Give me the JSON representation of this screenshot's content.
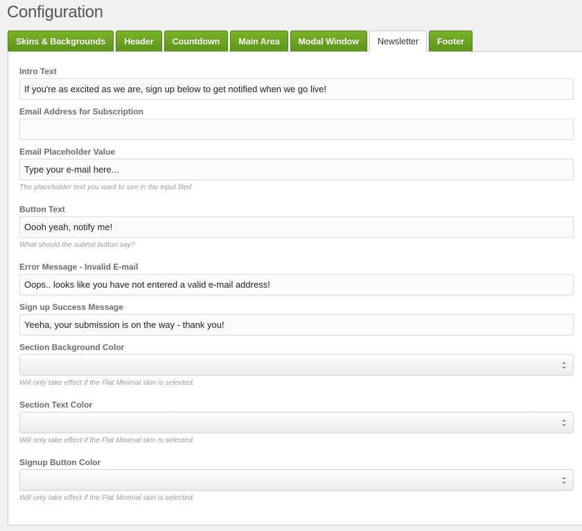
{
  "page": {
    "title": "Configuration"
  },
  "tabs": [
    {
      "label": "Skins & Backgrounds"
    },
    {
      "label": "Header"
    },
    {
      "label": "Countdown"
    },
    {
      "label": "Main Area"
    },
    {
      "label": "Modal Window"
    },
    {
      "label": "Newsletter"
    },
    {
      "label": "Footer"
    }
  ],
  "active_tab": "Newsletter",
  "fields": {
    "intro_text": {
      "label": "Intro Text",
      "value": "If you're as excited as we are, sign up below to get notified when we go live!"
    },
    "email_address": {
      "label": "Email Address for Subscription",
      "value": ""
    },
    "email_placeholder": {
      "label": "Email Placeholder Value",
      "value": "Type your e-mail here...",
      "help": "The placeholder text you want to see in the input filed"
    },
    "button_text": {
      "label": "Button Text",
      "value": "Oooh yeah, notify me!",
      "help": "What should the submit button say?"
    },
    "error_message": {
      "label": "Error Message - Invalid E-mail",
      "value": "Oops.. looks like you have not entered a valid e-mail address!"
    },
    "success_message": {
      "label": "Sign up Success Message",
      "value": "Yeeha, your submission is on the way - thank you!"
    },
    "section_bg_color": {
      "label": "Section Background Color",
      "value": "",
      "help": "Will only take effect if the Flat Minimal skin is selected."
    },
    "section_text_color": {
      "label": "Section Text Color",
      "value": "",
      "help": "Will only take effect if the Flat Minimal skin is selected."
    },
    "signup_button_color": {
      "label": "Signup Button Color",
      "value": "",
      "help": "Will only take effect if the Flat Minimal skin is selected."
    }
  },
  "colors": {
    "tab_green": "#6aa321",
    "label_gray": "#6b6b6b"
  }
}
